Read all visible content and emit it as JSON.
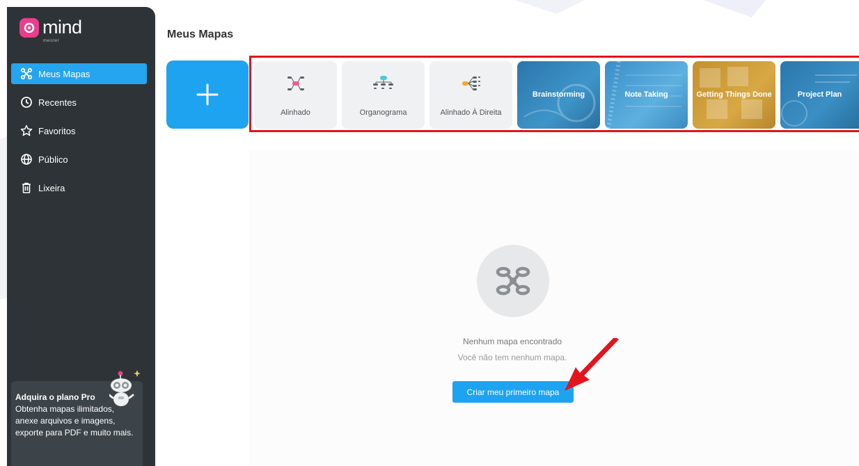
{
  "app": {
    "logo_text": "mind",
    "logo_sub": "meister"
  },
  "page": {
    "title": "Meus Mapas"
  },
  "sidebar": {
    "items": [
      {
        "label": "Meus Mapas",
        "icon": "mindmap-icon",
        "active": true
      },
      {
        "label": "Recentes",
        "icon": "clock-icon"
      },
      {
        "label": "Favoritos",
        "icon": "star-icon"
      },
      {
        "label": "Público",
        "icon": "globe-icon"
      },
      {
        "label": "Lixeira",
        "icon": "trash-icon"
      }
    ],
    "promo": {
      "title": "Adquira o plano Pro",
      "text": "Obtenha mapas ilimitados, anexe arquivos e imagens, exporte para PDF e muito mais."
    }
  },
  "new_map": {
    "icon": "plus-icon"
  },
  "templates": [
    {
      "label": "Alinhado",
      "style": "plain",
      "icon": "aligned-map-icon"
    },
    {
      "label": "Organograma",
      "style": "plain",
      "icon": "org-chart-icon"
    },
    {
      "label": "Alinhado À Direita",
      "style": "plain",
      "icon": "right-aligned-map-icon"
    },
    {
      "label": "Brainstorming",
      "style": "image",
      "color": "#2e7fb5"
    },
    {
      "label": "Note Taking",
      "style": "image",
      "color": "#3f97cf"
    },
    {
      "label": "Getting Things Done",
      "style": "image",
      "color": "#c9982f"
    },
    {
      "label": "Project Plan",
      "style": "image",
      "color": "#2a78ad"
    }
  ],
  "empty_state": {
    "icon": "mindmap-icon",
    "line1": "Nenhum mapa encontrado",
    "line2": "Você não tem nenhum mapa.",
    "button": "Criar meu primeiro mapa"
  },
  "colors": {
    "accent": "#1ea3f1",
    "sidebar": "#2d3337",
    "highlight": "#e3141b",
    "logo": "#e83e8c"
  }
}
